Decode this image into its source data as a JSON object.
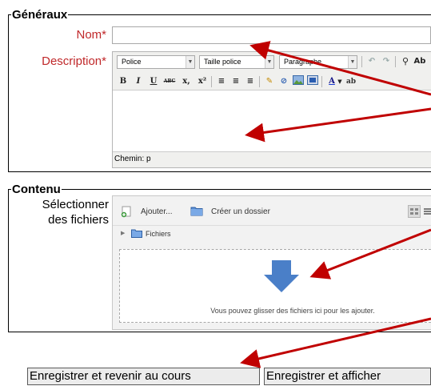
{
  "general": {
    "legend": "Généraux",
    "name_label": "Nom",
    "name_value": "",
    "description_label": "Description",
    "required_mark": "*"
  },
  "editor": {
    "font_select": "Police",
    "size_select": "Taille police",
    "para_select": "Paragraphe",
    "path_label": "Chemin: p",
    "buttons": {
      "bold": "B",
      "italic": "I",
      "underline": "U",
      "strike": "ABC",
      "subscript": "x,",
      "superscript": "x²"
    }
  },
  "content": {
    "legend": "Contenu",
    "select_files_label_line1": "Sélectionner",
    "select_files_label_line2": "des fichiers",
    "add_button": "Ajouter...",
    "create_folder_button": "Créer un dossier",
    "folder_path": "Fichiers",
    "drop_hint": "Vous pouvez glisser des fichiers ici pour les ajouter."
  },
  "actions": {
    "save_return": "Enregistrer et revenir au cours",
    "save_display": "Enregistrer et afficher"
  },
  "colors": {
    "required": "#c0282a",
    "annotation_arrow": "#c00000",
    "drop_arrow": "#4a7fc8"
  }
}
